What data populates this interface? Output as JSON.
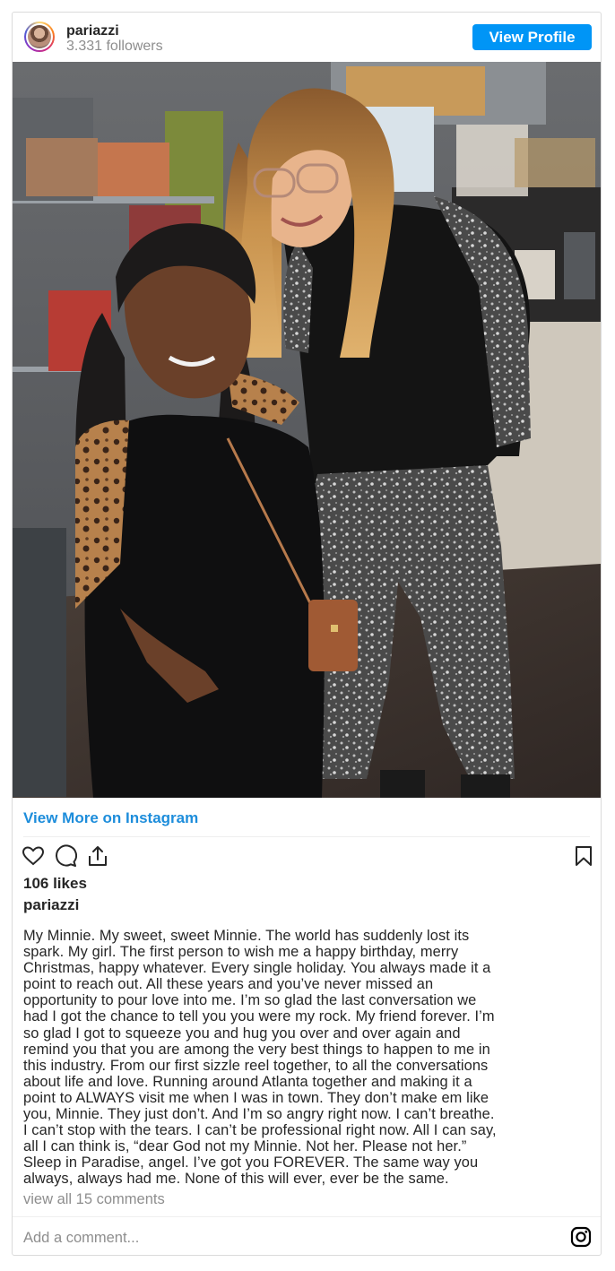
{
  "header": {
    "username": "pariazzi",
    "followers": "3.331 followers",
    "view_profile_label": "View Profile",
    "avatar_icon": "profile-avatar"
  },
  "media": {
    "photo_icon": "photo-two-women"
  },
  "links": {
    "view_more": "View More on Instagram"
  },
  "actions": {
    "like_icon": "heart-icon",
    "comment_icon": "comment-icon",
    "share_icon": "share-icon",
    "save_icon": "bookmark-icon"
  },
  "post": {
    "likes": "106 likes",
    "author": "pariazzi",
    "caption": "My Minnie. My sweet, sweet Minnie. The world has suddenly lost its\nspark. My girl. The first person to wish me a happy birthday, merry\nChristmas, happy whatever. Every single holiday. You always made it a\npoint to reach out. All these years and you’ve never missed an\nopportunity to pour love into me. I’m so glad the last conversation we\nhad I got the chance to tell you you were my rock. My friend forever. I’m\nso glad I got to squeeze you and hug you over and over again and\nremind you that you are among the very best things to happen to me in\nthis industry. From our first sizzle reel together, to all the conversations\nabout life and love. Running around Atlanta together and making it a\npoint to ALWAYS visit me when I was in town. They don’t make em like\nyou, Minnie. They just don’t. And I’m so angry right now. I can’t breathe.\nI can’t stop with the tears. I can’t be professional right now. All I can say,\nall I can think is, “dear God not my Minnie. Not her. Please not her.”\nSleep in Paradise, angel. I’ve got you FOREVER. The same way you\nalways, always had me. None of this will ever, ever be the same.",
    "view_comments": "view all 15 comments"
  },
  "comment": {
    "placeholder": "Add a comment...",
    "instagram_icon": "instagram-icon"
  },
  "colors": {
    "accent": "#0095f6",
    "link": "#1d8ddb",
    "muted": "#8e8e8e",
    "text": "#262626",
    "border": "#dbdbdb"
  }
}
